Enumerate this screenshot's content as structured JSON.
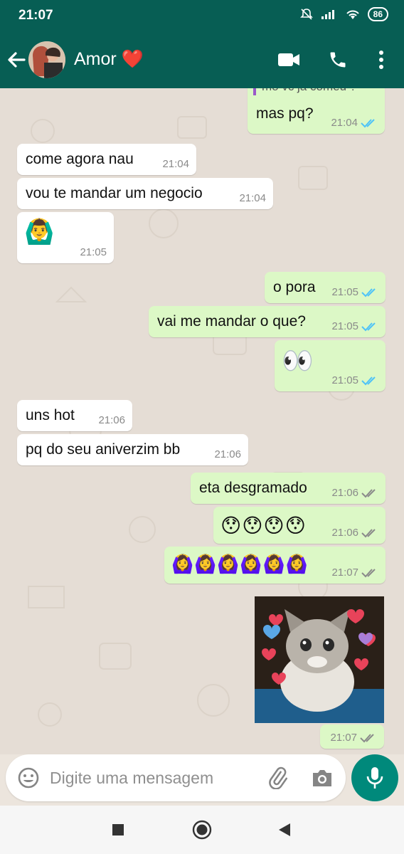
{
  "status_bar": {
    "time": "21:07",
    "battery": "86",
    "icons": [
      "mute-bell-icon",
      "signal-icon",
      "wifi-icon",
      "battery-icon"
    ]
  },
  "header": {
    "contact_name": "Amor ❤️",
    "actions": [
      "video-call-icon",
      "voice-call-icon",
      "more-options-icon"
    ]
  },
  "messages": [
    {
      "dir": "out",
      "quoted_text": "mo vc ja comeu ?",
      "text": "mas pq?",
      "time": "21:04",
      "status": "read"
    },
    {
      "dir": "in",
      "text": "come agora nau",
      "time": "21:04"
    },
    {
      "dir": "in",
      "text": "vou te mandar um negocio",
      "time": "21:04"
    },
    {
      "dir": "in",
      "text": "🙆‍♂️",
      "time": "21:05"
    },
    {
      "dir": "out",
      "text": "o pora",
      "time": "21:05",
      "status": "read"
    },
    {
      "dir": "out",
      "text": "vai me mandar o que?",
      "time": "21:05",
      "status": "read"
    },
    {
      "dir": "out",
      "text": "👀",
      "time": "21:05",
      "status": "read"
    },
    {
      "dir": "in",
      "text": "uns hot",
      "time": "21:06"
    },
    {
      "dir": "in",
      "text": "pq do seu aniverzim bb",
      "time": "21:06"
    },
    {
      "dir": "out",
      "text": "eta desgramado",
      "time": "21:06",
      "status": "delivered"
    },
    {
      "dir": "out",
      "text": "😯😯😯😯",
      "time": "21:06",
      "status": "delivered"
    },
    {
      "dir": "out",
      "text": "🙆‍♀️🙆‍♀️🙆‍♀️🙆‍♀️🙆‍♀️🙆‍♀️",
      "time": "21:07",
      "status": "delivered"
    },
    {
      "dir": "out",
      "type": "image",
      "image": "crying-kitten-with-hearts",
      "time": "21:07",
      "status": "delivered"
    }
  ],
  "input": {
    "placeholder": "Digite uma mensagem",
    "icons": [
      "emoji-icon",
      "attach-icon",
      "camera-icon",
      "mic-icon"
    ]
  },
  "nav_bar": [
    "recents-icon",
    "home-icon",
    "back-icon"
  ],
  "colors": {
    "header": "#075e54",
    "outgoing_bubble": "#dcf8c6",
    "incoming_bubble": "#ffffff",
    "read_tick": "#4fc3f7",
    "mic_button": "#00897b"
  }
}
